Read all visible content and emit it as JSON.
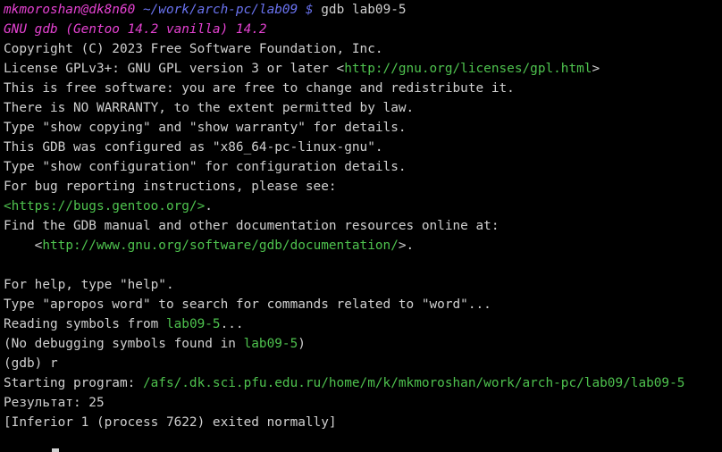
{
  "prompt": {
    "user_host": "mkmoroshan@dk8n60",
    "path": "~/work/arch-pc/lab09",
    "symbol": "$",
    "command": "gdb lab09-5"
  },
  "lines": {
    "l1": "GNU gdb (Gentoo 14.2 vanilla) 14.2",
    "l2": "Copyright (C) 2023 Free Software Foundation, Inc.",
    "l3_pre": "License GPLv3+: GNU GPL version 3 or later <",
    "l3_link": "http://gnu.org/licenses/gpl.html",
    "l3_post": ">",
    "l4": "This is free software: you are free to change and redistribute it.",
    "l5": "There is NO WARRANTY, to the extent permitted by law.",
    "l6": "Type \"show copying\" and \"show warranty\" for details.",
    "l7": "This GDB was configured as \"x86_64-pc-linux-gnu\".",
    "l8": "Type \"show configuration\" for configuration details.",
    "l9": "For bug reporting instructions, please see:",
    "l10_link": "<https://bugs.gentoo.org/>",
    "l10_post": ".",
    "l11": "Find the GDB manual and other documentation resources online at:",
    "l12_pre": "    <",
    "l12_link": "http://www.gnu.org/software/gdb/documentation/",
    "l12_post": ">.",
    "l14": "For help, type \"help\".",
    "l15": "Type \"apropos word\" to search for commands related to \"word\"...",
    "l16_pre": "Reading symbols from ",
    "l16_file": "lab09-5",
    "l16_post": "...",
    "l17_pre": "(No debugging symbols found in ",
    "l17_file": "lab09-5",
    "l17_post": ")",
    "l18": "(gdb) r",
    "l19_pre": "Starting program: ",
    "l19_path": "/afs/.dk.sci.pfu.edu.ru/home/m/k/mkmoroshan/work/arch-pc/lab09/lab09-5",
    "l20": "Результат: 25",
    "l21": "[Inferior 1 (process 7622) exited normally]"
  },
  "colors": {
    "background": "#000000",
    "text": "#d0d0d0",
    "magenta": "#e542d2",
    "path_blue": "#6a73f0",
    "link_green": "#4ec24e"
  }
}
